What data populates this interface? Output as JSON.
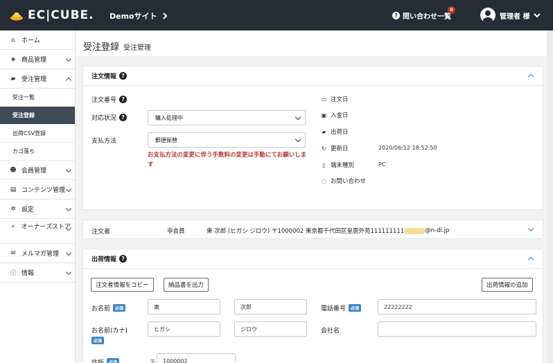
{
  "header": {
    "logo_text": "EC|CUBE.",
    "site_link": "Demoサイト",
    "inquiry_label": "問い合わせ一覧",
    "inquiry_count": "0",
    "user_label": "管理者 様"
  },
  "sidebar": {
    "items": [
      {
        "label": "ホーム",
        "icon": "home-icon"
      },
      {
        "label": "商品管理",
        "icon": "cube-icon"
      },
      {
        "label": "受注管理",
        "icon": "cart-icon"
      },
      {
        "label": "会員管理",
        "icon": "users-icon"
      },
      {
        "label": "コンテンツ管理",
        "icon": "file-icon"
      },
      {
        "label": "設定",
        "icon": "gear-icon"
      },
      {
        "label": "オーナーズストア",
        "icon": "plug-icon"
      },
      {
        "label": "メルマガ管理",
        "icon": "envelope-icon"
      },
      {
        "label": "情報",
        "icon": "info-icon"
      }
    ],
    "sub_items": [
      "受注一覧",
      "受注登録",
      "出荷CSV登録",
      "カゴ落ち"
    ]
  },
  "page": {
    "title": "受注登録",
    "subtitle": "受注管理"
  },
  "order_info": {
    "heading": "注文情報",
    "order_no_label": "注文番号",
    "status_label": "対応状況",
    "status_value": "購入処理中",
    "payment_label": "支払方法",
    "payment_value": "郵便振替",
    "warning": "お支払方法の変更に伴う手数料の変更は手動にてお願いします",
    "order_date_label": "注文日",
    "payment_date_label": "入金日",
    "ship_date_label": "出荷日",
    "updated_label": "更新日",
    "updated_value": "2020/06/12 18:52:50",
    "device_label": "端末種別",
    "device_value": "PC",
    "inquiry_label": "お問い合わせ"
  },
  "customer": {
    "label": "注文者",
    "type": "非会員",
    "summary": "東 次郎 (ヒガシ ジロウ) 〒1000002 東京都千代田区皇居外苑111111111",
    "email_tail": "@n-di.jp"
  },
  "shipping": {
    "heading": "出荷情報",
    "copy_button": "注文者情報をコピー",
    "slip_button": "納品書を出力",
    "add_button": "出荷情報の追加",
    "name_label": "お名前",
    "kana_label": "お名前(カナ)",
    "required": "必須",
    "last_name": "東",
    "first_name": "次郎",
    "last_kana": "ヒガシ",
    "first_kana": "ジロウ",
    "tel_label": "電話番号",
    "tel_value": "22222222",
    "company_label": "会社名",
    "address_label": "住所",
    "zip_value": "1000002"
  }
}
